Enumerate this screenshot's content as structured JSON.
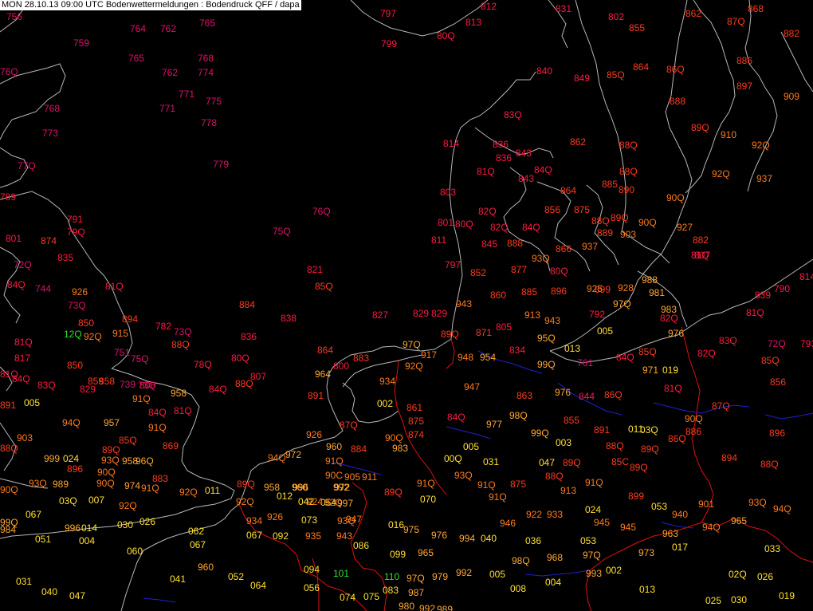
{
  "header": {
    "title": "MON 28.10.13 09:00 UTC  Bodenwettermeldungen :  Bodendruck QFF / dapa"
  },
  "colors": {
    "background": "#000000",
    "coastline": "#b8b8b8",
    "border": "#e01010",
    "river": "#2020d0",
    "pressure_low": "#e0106a",
    "pressure_mid_low": "#ff1a40",
    "pressure_mid": "#ff3a1e",
    "pressure_mid_high": "#ff7a1a",
    "pressure_high": "#ffa832",
    "pressure_very_high": "#ffe030",
    "pressure_extreme": "#30e030"
  },
  "stations": [
    "756",
    "764",
    "762",
    "765",
    "759",
    "797",
    "813",
    "812",
    "80Q",
    "799",
    "831",
    "802",
    "855",
    "862",
    "868",
    "87Q",
    "882",
    "765",
    "768",
    "762",
    "774",
    "76Q",
    "840",
    "849",
    "85Q",
    "864",
    "86Q",
    "886",
    "897",
    "909",
    "771",
    "768",
    "771",
    "775",
    "773",
    "778",
    "888",
    "83Q",
    "89Q",
    "910",
    "862",
    "92Q",
    "77Q",
    "779",
    "814",
    "836",
    "836",
    "843",
    "88Q",
    "92Q",
    "937",
    "81Q",
    "84Q",
    "88Q",
    "843",
    "789",
    "803",
    "864",
    "885",
    "890",
    "90Q",
    "76Q",
    "856",
    "875",
    "88Q",
    "89Q",
    "90Q",
    "927",
    "791",
    "82Q",
    "82Q",
    "84Q",
    "889",
    "903",
    "801",
    "80Q",
    "811",
    "79Q",
    "75Q",
    "882",
    "845",
    "888",
    "937",
    "807",
    "801",
    "874",
    "866",
    "93Q",
    "81Q",
    "797",
    "835",
    "852",
    "877",
    "80Q",
    "72Q",
    "821",
    "84Q",
    "899",
    "928",
    "988",
    "814",
    "744",
    "85Q",
    "860",
    "885",
    "896",
    "925",
    "981",
    "790",
    "81Q",
    "926",
    "97Q",
    "839",
    "943",
    "983",
    "81Q",
    "73Q",
    "884",
    "913",
    "792",
    "827",
    "829",
    "829",
    "806",
    "894",
    "943",
    "82Q",
    "850",
    "871",
    "805",
    "800",
    "782",
    "73Q",
    "838",
    "89Q",
    "95Q",
    "976",
    "83Q",
    "81Q",
    "12Q",
    "92Q",
    "915",
    "005",
    "013",
    "72Q",
    "793",
    "836",
    "88Q",
    "97Q",
    "834",
    "82Q",
    "817",
    "751",
    "75Q",
    "80Q",
    "864",
    "883",
    "948",
    "954",
    "84Q",
    "85Q",
    "850",
    "917",
    "92Q",
    "99Q",
    "761",
    "85Q",
    "78Q",
    "964",
    "971",
    "019",
    "856",
    "81Q",
    "84Q",
    "859",
    "858",
    "83Q",
    "829",
    "739",
    "73Q",
    "84Q",
    "88Q",
    "807",
    "934",
    "947",
    "958",
    "976",
    "844",
    "86Q",
    "81Q",
    "91Q",
    "005",
    "84Q",
    "81Q",
    "863",
    "87Q",
    "891",
    "891",
    "002",
    "861",
    "875",
    "84Q",
    "90Q",
    "91Q",
    "94Q",
    "957",
    "977",
    "98Q",
    "99Q",
    "855",
    "891",
    "011",
    "03Q",
    "87Q",
    "90Q",
    "886",
    "896",
    "85Q",
    "874",
    "903",
    "926",
    "960",
    "983",
    "005",
    "003",
    "88Q",
    "86Q",
    "88Q",
    "89Q",
    "024",
    "89Q",
    "869",
    "884",
    "93Q",
    "958",
    "96Q",
    "999",
    "00Q",
    "031",
    "047",
    "89Q",
    "85C",
    "89Q",
    "894",
    "88Q",
    "94Q",
    "972",
    "896",
    "91Q",
    "90Q",
    "90C",
    "93Q",
    "88Q",
    "905",
    "911",
    "883",
    "89Q",
    "90Q",
    "93Q",
    "989",
    "89Q",
    "958",
    "974",
    "996",
    "992",
    "90Q",
    "91Q",
    "91Q",
    "875",
    "91Q",
    "913",
    "91Q",
    "92Q",
    "960",
    "972",
    "011",
    "012",
    "042",
    "054",
    "070",
    "91Q",
    "899",
    "901",
    "93Q",
    "94Q",
    "03Q",
    "007",
    "92Q",
    "92Q",
    "924",
    "92Q",
    "997",
    "99Q",
    "996",
    "016",
    "024",
    "053",
    "067",
    "073",
    "93Q",
    "934",
    "926",
    "922",
    "933",
    "946",
    "945",
    "945",
    "940",
    "94Q",
    "965",
    "984",
    "004",
    "014",
    "030",
    "026",
    "062",
    "067",
    "092",
    "935",
    "943",
    "947",
    "975",
    "976",
    "994",
    "040",
    "036",
    "053",
    "963",
    "033",
    "051",
    "060",
    "067",
    "086",
    "099",
    "965",
    "968",
    "97Q",
    "973",
    "960",
    "98Q",
    "993",
    "002",
    "017",
    "02Q",
    "026",
    "031",
    "041",
    "052",
    "064",
    "094",
    "101",
    "110",
    "97Q",
    "979",
    "992",
    "005",
    "008",
    "004",
    "013",
    "025",
    "030",
    "019",
    "040",
    "047",
    "056",
    "074",
    "075",
    "083",
    "987",
    "980",
    "992",
    "989"
  ]
}
